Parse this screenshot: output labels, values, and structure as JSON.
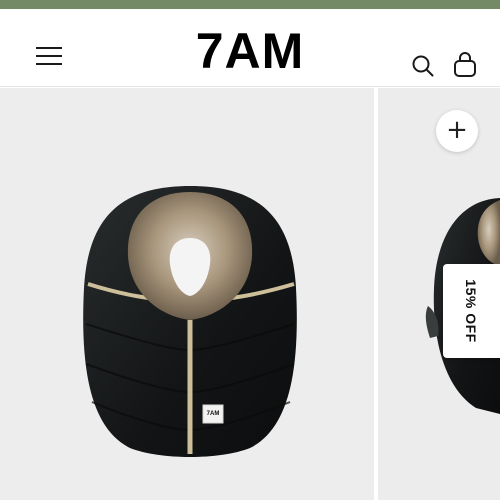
{
  "colors": {
    "top_bar": "#748a67",
    "product_fabric": "#16191a",
    "fur_trim": "#9c8a72",
    "piping": "#cdbf9a",
    "image_background": "#ededed"
  },
  "header": {
    "logo": "7AM",
    "menu_icon": "hamburger-menu-icon",
    "search_icon": "search-icon",
    "cart_icon": "shopping-bag-icon"
  },
  "gallery": {
    "main_image": "black puffer car seat cover with fur-trimmed opening",
    "tag_text": "7AM",
    "zoom_icon": "plus-icon",
    "zoom_label": "+"
  },
  "promo_tab": {
    "label": "15% OFF"
  }
}
